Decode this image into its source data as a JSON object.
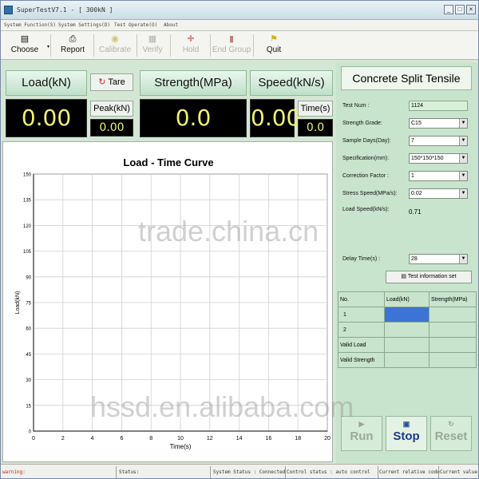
{
  "window": {
    "title": "SuperTestV7.1 - [ 300kN ]"
  },
  "menu": [
    "System Function(S)",
    "System Settings(D)",
    "Test Operate(O)",
    "About"
  ],
  "toolbar": [
    {
      "label": "Choose",
      "icon": "choose-icon",
      "enabled": true
    },
    {
      "label": "Report",
      "icon": "printer-icon",
      "enabled": true
    },
    {
      "label": "Calibrate",
      "icon": "calibrate-icon",
      "enabled": false
    },
    {
      "label": "Verify",
      "icon": "verify-icon",
      "enabled": false
    },
    {
      "label": "Hold",
      "icon": "hold-icon",
      "enabled": false
    },
    {
      "label": "End Group",
      "icon": "end-group-icon",
      "enabled": false
    },
    {
      "label": "Quit",
      "icon": "quit-icon",
      "enabled": true
    }
  ],
  "readouts": {
    "load_label": "Load(kN)",
    "load_value": "0.00",
    "tare_label": "Tare",
    "peak_label": "Peak(kN)",
    "peak_value": "0.00",
    "stress_label": "Strength(MPa)",
    "stress_value": "0.0",
    "speed_label": "Speed(kN/s)",
    "speed_value": "0.00",
    "time_label": "Time(s)",
    "time_value": "0.0"
  },
  "chart_data": {
    "type": "line",
    "title": "Load - Time Curve",
    "xlabel": "Time(s)",
    "ylabel": "Load(kN)",
    "xlim": [
      0,
      20
    ],
    "ylim": [
      0,
      150
    ],
    "x_ticks": [
      0,
      2,
      4,
      6,
      8,
      10,
      12,
      14,
      16,
      18,
      20
    ],
    "y_ticks": [
      0,
      15,
      30,
      45,
      60,
      75,
      90,
      105,
      120,
      135,
      150
    ],
    "grid": true,
    "series": []
  },
  "panel": {
    "title": "Concrete Split Tensile",
    "fields": [
      {
        "label": "Test Num :",
        "value": "1124",
        "kind": "text"
      },
      {
        "label": "Strength Grade:",
        "value": "C15",
        "kind": "select"
      },
      {
        "label": "Sample Days(Day):",
        "value": "7",
        "kind": "select"
      },
      {
        "label": "Specification(mm):",
        "value": "150*150*150",
        "kind": "select"
      },
      {
        "label": "Correction Factor :",
        "value": "1",
        "kind": "select"
      },
      {
        "label": "Stress Speed(MPa/s):",
        "value": "0.02",
        "kind": "select"
      },
      {
        "label": "Load Speed(kN/s):",
        "value": "0.71",
        "kind": "plain"
      }
    ],
    "delay_label": "Delay Time(s) :",
    "delay_value": "28",
    "info_button": "Test information set",
    "table": {
      "headers": [
        "No.",
        "Load(kN)",
        "Strength(MPa)"
      ],
      "rows": [
        "1",
        "2",
        "Valid Load",
        "Valid Strength"
      ]
    },
    "buttons": {
      "run": "Run",
      "stop": "Stop",
      "reset": "Reset"
    }
  },
  "status": {
    "warning": "warning:",
    "status": "Status:",
    "system": "System Status : Connected",
    "control": "Control status : auto control",
    "code": "Current relative code",
    "value": "Current value"
  },
  "watermarks": [
    "trade.china.cn",
    "hssd.en.alibaba.com"
  ]
}
